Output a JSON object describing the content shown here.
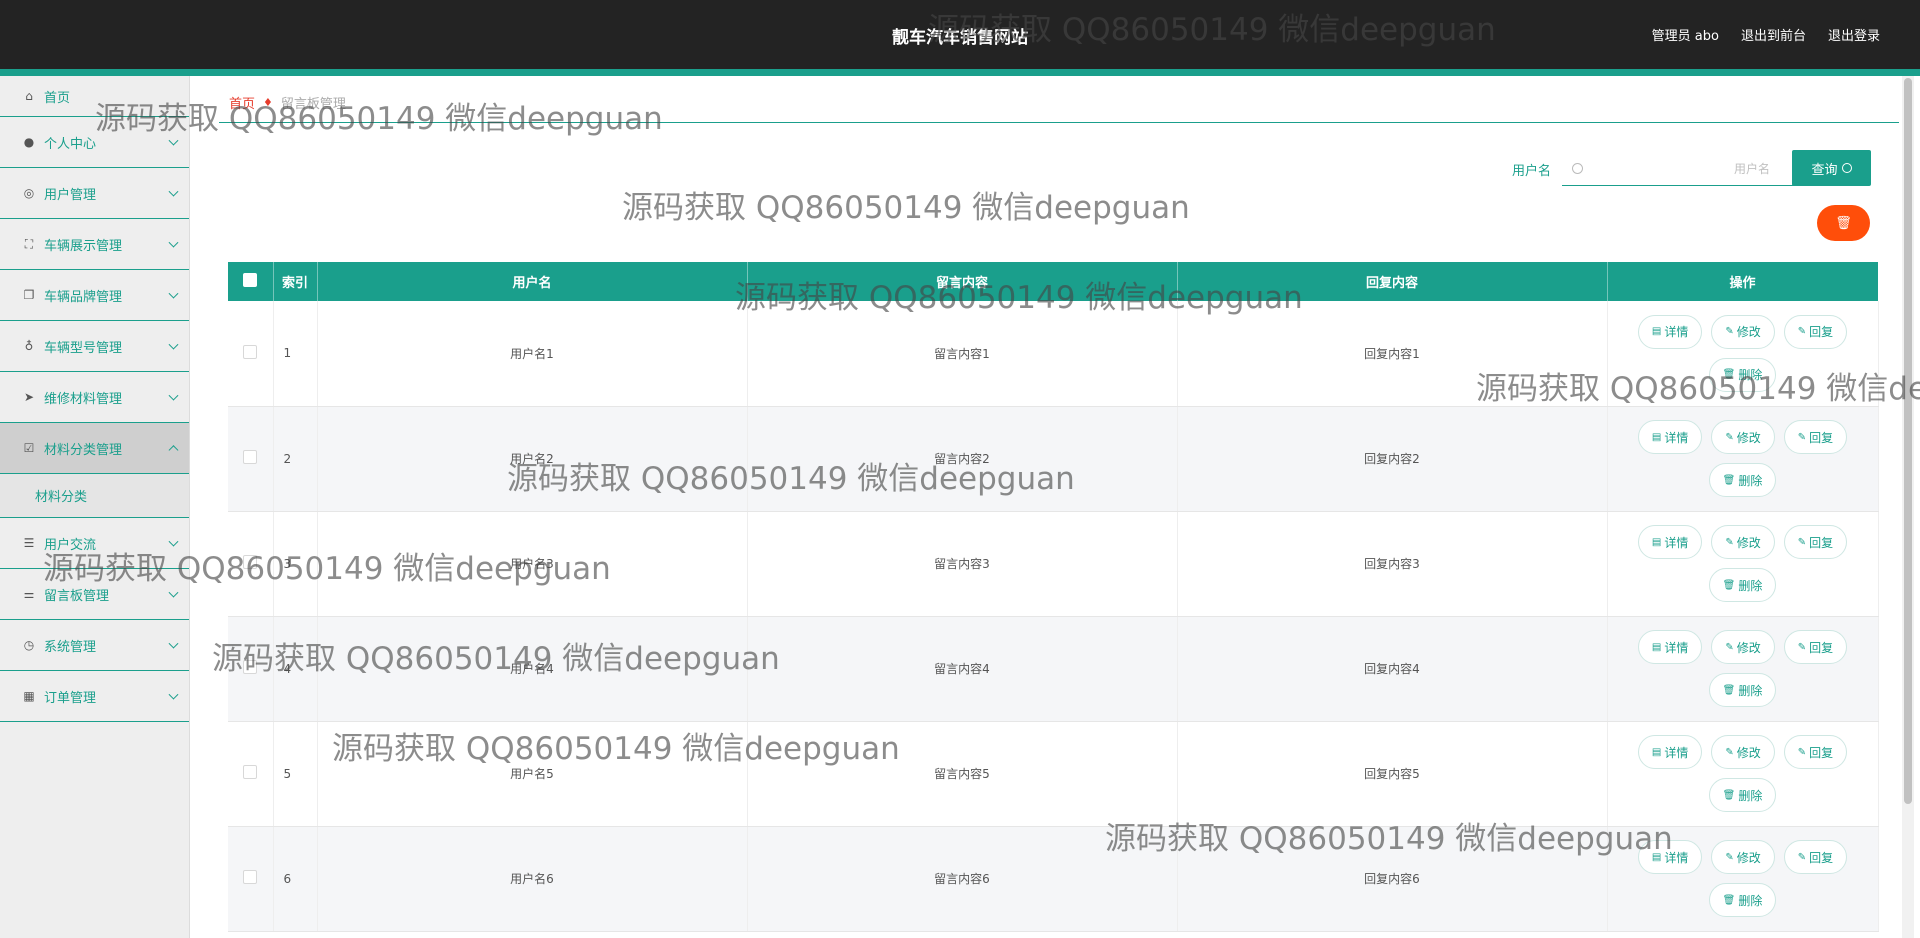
{
  "header": {
    "site_title": "靓车汽车销售网站",
    "admin_label": "管理员 abo",
    "back_to_front": "退出到前台",
    "logout": "退出登录"
  },
  "sidebar": {
    "items": [
      {
        "label": "首页",
        "icon": "home-icon"
      },
      {
        "label": "个人中心",
        "icon": "user-icon"
      },
      {
        "label": "用户管理",
        "icon": "support-icon"
      },
      {
        "label": "车辆展示管理",
        "icon": "fullscreen-icon"
      },
      {
        "label": "车辆品牌管理",
        "icon": "copy-icon"
      },
      {
        "label": "车辆型号管理",
        "icon": "microphone-icon"
      },
      {
        "label": "维修材料管理",
        "icon": "send-icon"
      },
      {
        "label": "材料分类管理",
        "icon": "checkbox-icon"
      },
      {
        "label": "用户交流",
        "icon": "list-icon"
      },
      {
        "label": "留言板管理",
        "icon": "sliders-icon"
      },
      {
        "label": "系统管理",
        "icon": "compass-icon"
      },
      {
        "label": "订单管理",
        "icon": "grid-icon"
      }
    ],
    "submenu": {
      "label": "材料分类"
    }
  },
  "breadcrumb": {
    "home": "首页",
    "current": "留言板管理"
  },
  "search": {
    "label": "用户名",
    "placeholder": "用户名",
    "query_button": "查询"
  },
  "table": {
    "columns": [
      "索引",
      "用户名",
      "留言内容",
      "回复内容",
      "操作"
    ],
    "rows": [
      {
        "index": "1",
        "username": "用户名1",
        "message": "留言内容1",
        "reply": "回复内容1"
      },
      {
        "index": "2",
        "username": "用户名2",
        "message": "留言内容2",
        "reply": "回复内容2"
      },
      {
        "index": "3",
        "username": "用户名3",
        "message": "留言内容3",
        "reply": "回复内容3"
      },
      {
        "index": "4",
        "username": "用户名4",
        "message": "留言内容4",
        "reply": "回复内容4"
      },
      {
        "index": "5",
        "username": "用户名5",
        "message": "留言内容5",
        "reply": "回复内容5"
      },
      {
        "index": "6",
        "username": "用户名6",
        "message": "留言内容6",
        "reply": "回复内容6"
      }
    ],
    "actions": {
      "detail": "详情",
      "edit": "修改",
      "reply": "回复",
      "delete": "删除"
    }
  },
  "watermark_text": "源码获取 QQ86050149 微信deepguan",
  "colors": {
    "primary": "#1a9f8c",
    "header_bg": "#232323",
    "danger": "#ff4e0a",
    "breadcrumb_home": "#e63c2c"
  }
}
